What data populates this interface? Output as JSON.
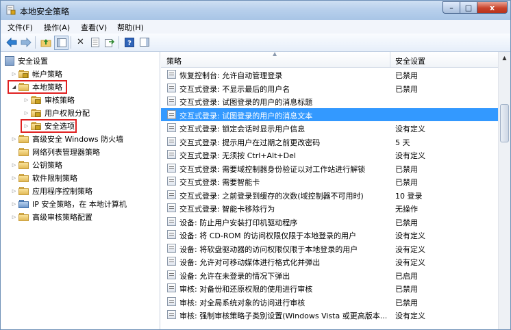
{
  "window": {
    "title": "本地安全策略",
    "controls": {
      "minimize": "–",
      "maximize": "□",
      "close": "x"
    }
  },
  "menu": [
    "文件(F)",
    "操作(A)",
    "查看(V)",
    "帮助(H)"
  ],
  "toolbar_icons": [
    "back-arrow-icon",
    "forward-arrow-icon",
    "up-folder-icon",
    "console-tree-icon",
    "delete-icon",
    "properties-icon",
    "export-list-icon",
    "help-icon",
    "show-hide-pane-icon"
  ],
  "tree": {
    "root": "安全设置",
    "items": [
      {
        "label": "帐户策略"
      },
      {
        "label": "本地策略"
      },
      {
        "label": "审核策略"
      },
      {
        "label": "用户权限分配"
      },
      {
        "label": "安全选项"
      },
      {
        "label": "高级安全 Windows 防火墙"
      },
      {
        "label": "网络列表管理器策略"
      },
      {
        "label": "公钥策略"
      },
      {
        "label": "软件限制策略"
      },
      {
        "label": "应用程序控制策略"
      },
      {
        "label": "IP 安全策略，在 本地计算机"
      },
      {
        "label": "高级审核策略配置"
      }
    ]
  },
  "list": {
    "columns": [
      "策略",
      "安全设置"
    ],
    "rows": [
      {
        "name": "恢复控制台: 允许自动管理登录",
        "value": "已禁用"
      },
      {
        "name": "交互式登录: 不显示最后的用户名",
        "value": "已禁用"
      },
      {
        "name": "交互式登录: 试图登录的用户的消息标题",
        "value": ""
      },
      {
        "name": "交互式登录: 试图登录的用户的消息文本",
        "value": ""
      },
      {
        "name": "交互式登录: 锁定会话时显示用户信息",
        "value": "没有定义"
      },
      {
        "name": "交互式登录: 提示用户在过期之前更改密码",
        "value": "5 天"
      },
      {
        "name": "交互式登录: 无须按 Ctrl+Alt+Del",
        "value": "没有定义"
      },
      {
        "name": "交互式登录: 需要域控制器身份验证以对工作站进行解锁",
        "value": "已禁用"
      },
      {
        "name": "交互式登录: 需要智能卡",
        "value": "已禁用"
      },
      {
        "name": "交互式登录: 之前登录到缓存的次数(域控制器不可用时)",
        "value": "10 登录"
      },
      {
        "name": "交互式登录: 智能卡移除行为",
        "value": "无操作"
      },
      {
        "name": "设备: 防止用户安装打印机驱动程序",
        "value": "已禁用"
      },
      {
        "name": "设备: 将 CD-ROM 的访问权限仅限于本地登录的用户",
        "value": "没有定义"
      },
      {
        "name": "设备: 将软盘驱动器的访问权限仅限于本地登录的用户",
        "value": "没有定义"
      },
      {
        "name": "设备: 允许对可移动媒体进行格式化并弹出",
        "value": "没有定义"
      },
      {
        "name": "设备: 允许在未登录的情况下弹出",
        "value": "已启用"
      },
      {
        "name": "审核: 对备份和还原权限的使用进行审核",
        "value": "已禁用"
      },
      {
        "name": "审核: 对全局系统对象的访问进行审核",
        "value": "已禁用"
      },
      {
        "name": "审核: 强制审核策略子类别设置(Windows Vista 或更高版本...",
        "value": "没有定义"
      }
    ]
  },
  "colors": {
    "selection": "#3399ff",
    "highlight_box": "#e02020"
  }
}
